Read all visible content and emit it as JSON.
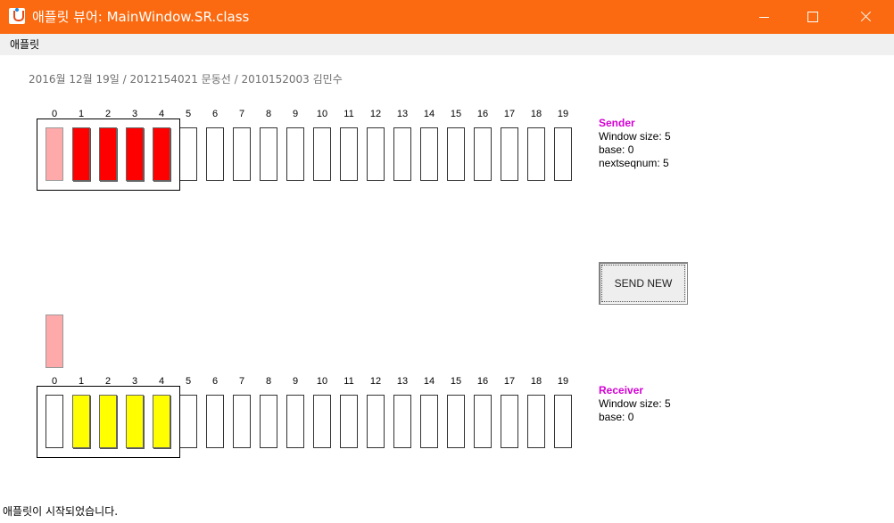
{
  "window": {
    "title": "애플릿 뷰어: MainWindow.SR.class"
  },
  "menu": {
    "applet_label": "애플릿"
  },
  "caption": "2016월 12월 19일 / 2012154021 문동선 / 2010152003 김민수",
  "indices": [
    "0",
    "1",
    "2",
    "3",
    "4",
    "5",
    "6",
    "7",
    "8",
    "9",
    "10",
    "11",
    "12",
    "13",
    "14",
    "15",
    "16",
    "17",
    "18",
    "19"
  ],
  "sender": {
    "heading": "Sender",
    "window_size": "Window size: 5",
    "base": "base: 0",
    "nextseqnum": "nextseqnum: 5",
    "cells": [
      "pending",
      "sent",
      "sent",
      "sent",
      "sent",
      "empty",
      "empty",
      "empty",
      "empty",
      "empty",
      "empty",
      "empty",
      "empty",
      "empty",
      "empty",
      "empty",
      "empty",
      "empty",
      "empty",
      "empty"
    ]
  },
  "receiver": {
    "heading": "Receiver",
    "window_size": "Window size: 5",
    "base": "base: 0",
    "cells": [
      "empty",
      "received",
      "received",
      "received",
      "received",
      "empty",
      "empty",
      "empty",
      "empty",
      "empty",
      "empty",
      "empty",
      "empty",
      "empty",
      "empty",
      "empty",
      "empty",
      "empty",
      "empty",
      "empty"
    ]
  },
  "controls": {
    "send_new_label": "SEND NEW"
  },
  "status": "애플릿이 시작되었습니다.",
  "colors": {
    "titlebar": "#fb6a10",
    "sent": "#ff0000",
    "pending": "#ffaaaa",
    "received": "#ffff00",
    "heading": "#d400d4"
  }
}
